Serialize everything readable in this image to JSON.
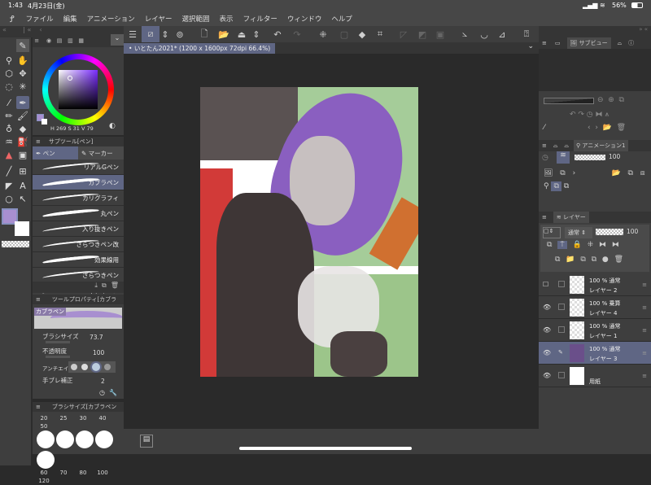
{
  "status": {
    "time": "1:43",
    "date": "4月23日(金)",
    "battery": "56%"
  },
  "menu": {
    "items": [
      "ファイル",
      "編集",
      "アニメーション",
      "レイヤー",
      "選択範囲",
      "表示",
      "フィルター",
      "ウィンドウ",
      "ヘルプ"
    ]
  },
  "document_tab": {
    "title": "いとたん2021* (1200 x 1600px 72dpi 66.4%)"
  },
  "color": {
    "h": "269",
    "s": "31",
    "v": "79",
    "main_color": "#a88fd0",
    "sub_color": "#ffffff"
  },
  "subtool": {
    "title": "サブツール[ペン]",
    "tabs": [
      "ペン",
      "マーカー"
    ],
    "items": [
      "リアルGペン",
      "カブラペン",
      "カリグラフィ",
      "丸ペン",
      "入り抜きペン",
      "ざらつきペン改",
      "効果線用",
      "ざらつきペン",
      "筆チャペン"
    ],
    "selected": 1
  },
  "tool_property": {
    "title": "ツールプロパティ[カブラ",
    "preview_label": "カブラペン",
    "brush_size_label": "ブラシサイズ",
    "brush_size": "73.7",
    "opacity_label": "不透明度",
    "opacity": "100",
    "antialias_label": "アンチエイリ",
    "stabilization_label": "手ブレ補正",
    "stabilization": "2"
  },
  "brush_size_panel": {
    "title": "ブラシサイズ[カブラペン",
    "sizes_row1": [
      "20",
      "25",
      "30",
      "40",
      "50"
    ],
    "sizes_row2": [
      "60",
      "70",
      "80",
      "100",
      "120"
    ]
  },
  "right": {
    "subview_tab": "サブビュー",
    "animation_tab": "アニメーション1",
    "animation_opacity": "100",
    "layer_tab": "レイヤー",
    "blend_mode": "通常",
    "layer_opacity": "100",
    "layers": [
      {
        "opacity": "100 %",
        "mode": "通常",
        "name": "レイヤー 2",
        "visible": false,
        "selected": false
      },
      {
        "opacity": "100 %",
        "mode": "乗算",
        "name": "レイヤー 4",
        "visible": true,
        "selected": false
      },
      {
        "opacity": "100 %",
        "mode": "通常",
        "name": "レイヤー 1",
        "visible": true,
        "selected": false
      },
      {
        "opacity": "100 %",
        "mode": "通常",
        "name": "レイヤー 3",
        "visible": true,
        "selected": true
      },
      {
        "opacity": "",
        "mode": "",
        "name": "用紙",
        "visible": true,
        "selected": false
      }
    ]
  }
}
